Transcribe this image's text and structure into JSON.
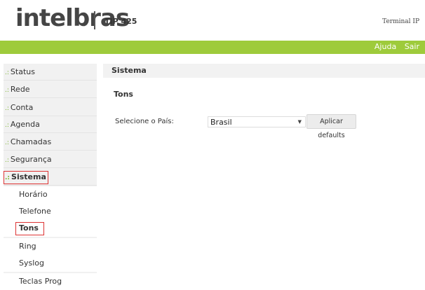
{
  "header": {
    "logo": "intelbras",
    "model": "TIP 425",
    "terminal_label": "Terminal IP"
  },
  "topbar": {
    "help": "Ajuda",
    "logout": "Sair"
  },
  "sidebar": {
    "bullet": ".:",
    "items": [
      {
        "label": "Status"
      },
      {
        "label": "Rede"
      },
      {
        "label": "Conta"
      },
      {
        "label": "Agenda"
      },
      {
        "label": "Chamadas"
      },
      {
        "label": "Segurança"
      },
      {
        "label": "Sistema"
      }
    ],
    "subitems": [
      {
        "label": "Horário"
      },
      {
        "label": "Telefone"
      },
      {
        "label": "Tons"
      },
      {
        "label": "Ring"
      },
      {
        "label": "Syslog"
      },
      {
        "label": "Teclas Prog"
      }
    ]
  },
  "content": {
    "heading": "Sistema",
    "section": "Tons",
    "country_label": "Selecione o País:",
    "country_value": "Brasil",
    "apply_button": "Aplicar defaults"
  },
  "colors": {
    "accent_green": "#9ecb3b",
    "highlight_red": "#dd3333"
  }
}
